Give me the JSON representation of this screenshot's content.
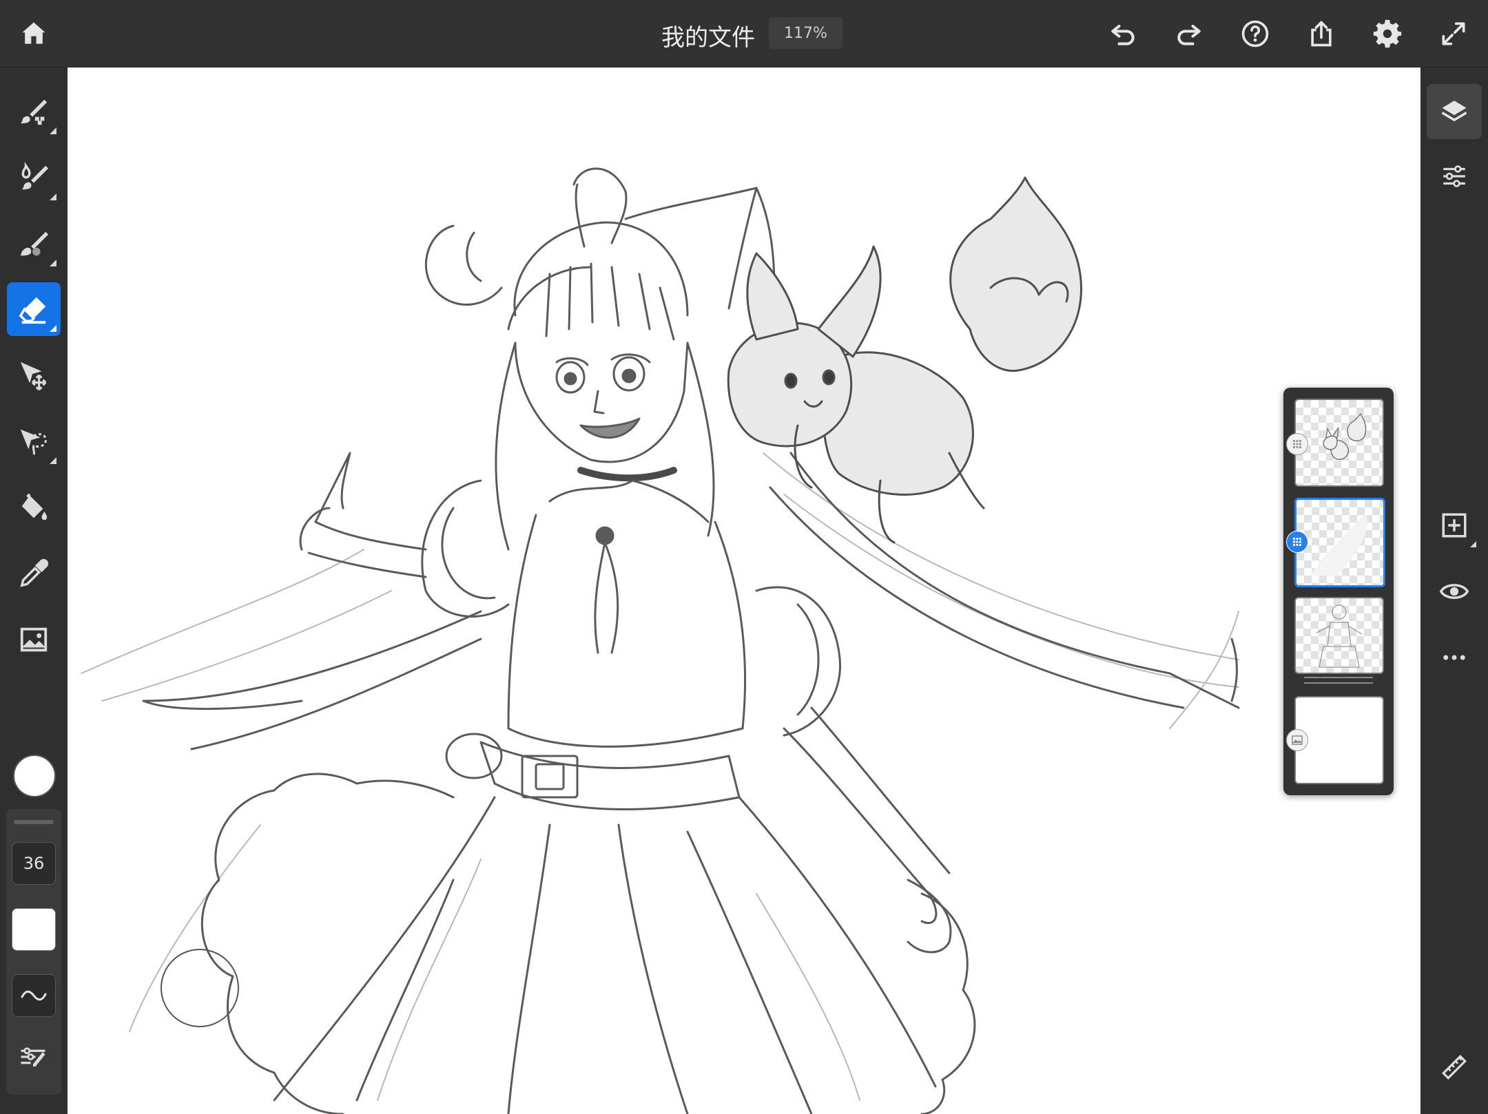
{
  "header": {
    "title": "我的文件",
    "zoom": "117%",
    "icons": [
      "home-icon",
      "undo-icon",
      "redo-icon",
      "help-icon",
      "share-icon",
      "settings-icon",
      "fullscreen-icon"
    ]
  },
  "left_toolbar": {
    "tools": [
      "pixel-brush",
      "live-brush",
      "vector-brush",
      "eraser",
      "transform",
      "selection",
      "fill",
      "eyedropper",
      "image"
    ],
    "active_tool": "eraser",
    "color": "#ffffff",
    "brush_size": "36"
  },
  "right_toolbar": {
    "icons": [
      "layers-icon",
      "layer-properties-icon",
      "add-layer-icon",
      "visibility-icon",
      "more-icon",
      "ruler-icon"
    ]
  },
  "layers": {
    "count": 4,
    "selected_index": 1,
    "accent_color": "#2680eb"
  }
}
